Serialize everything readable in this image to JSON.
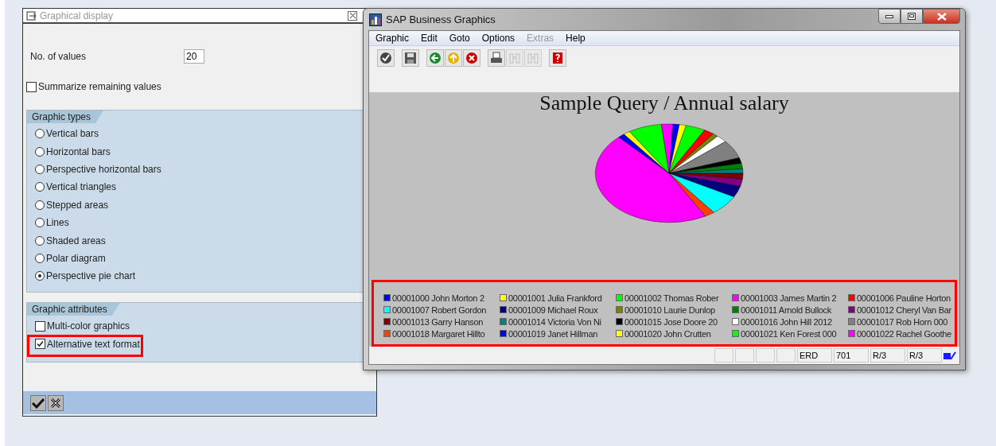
{
  "dialog": {
    "title": "Graphical display",
    "number_of_values": {
      "label": "No. of values",
      "value": "20"
    },
    "summarize": {
      "label": "Summarize remaining values",
      "checked": false
    },
    "graphic_types": {
      "title": "Graphic types",
      "options": [
        {
          "label": "Vertical bars",
          "selected": false
        },
        {
          "label": "Horizontal bars",
          "selected": false
        },
        {
          "label": "Perspective horizontal bars",
          "selected": false
        },
        {
          "label": "Vertical triangles",
          "selected": false
        },
        {
          "label": "Stepped areas",
          "selected": false
        },
        {
          "label": "Lines",
          "selected": false
        },
        {
          "label": "Shaded areas",
          "selected": false
        },
        {
          "label": "Polar diagram",
          "selected": false
        },
        {
          "label": "Perspective pie chart",
          "selected": true
        }
      ]
    },
    "graphic_attributes": {
      "title": "Graphic attributes",
      "options": [
        {
          "label": "Multi-color graphics",
          "checked": false,
          "highlighted": false
        },
        {
          "label": "Alternative text format",
          "checked": true,
          "highlighted": true
        }
      ]
    },
    "buttons": [
      {
        "kind": "confirm"
      },
      {
        "kind": "cancel"
      }
    ]
  },
  "graphics_window": {
    "title": "SAP Business Graphics",
    "menu": [
      {
        "label": "Graphic",
        "disabled": false
      },
      {
        "label": "Edit",
        "disabled": false
      },
      {
        "label": "Goto",
        "disabled": false
      },
      {
        "label": "Options",
        "disabled": false
      },
      {
        "label": "Extras",
        "disabled": true
      },
      {
        "label": "Help",
        "disabled": false
      }
    ],
    "toolbar": [
      {
        "kind": "check",
        "disabled": false
      },
      {
        "kind": "save",
        "disabled": false
      },
      {
        "kind": "back",
        "disabled": false
      },
      {
        "kind": "exit",
        "disabled": false
      },
      {
        "kind": "cancel",
        "disabled": false
      },
      {
        "kind": "print",
        "disabled": false
      },
      {
        "kind": "find",
        "disabled": true
      },
      {
        "kind": "find-next",
        "disabled": true
      },
      {
        "kind": "help",
        "disabled": false
      }
    ],
    "chart_title": "Sample Query / Annual salary",
    "legend": {
      "highlighted": true,
      "items": [
        {
          "label": "00001000 John Morton 2",
          "color": "#0000ff"
        },
        {
          "label": "00001001 Julia Frankford",
          "color": "#ffff00"
        },
        {
          "label": "00001002 Thomas Rober",
          "color": "#00ff00"
        },
        {
          "label": "00001003 James Martin 2",
          "color": "#ff00ff"
        },
        {
          "label": "00001006 Pauline Horton",
          "color": "#ff0000"
        },
        {
          "label": "00001007 Robert Gordon",
          "color": "#00ffff"
        },
        {
          "label": "00001009 Michael Roux",
          "color": "#000080"
        },
        {
          "label": "00001010 Laurie Dunlop",
          "color": "#808000"
        },
        {
          "label": "00001011 Arnold Bullock",
          "color": "#008000"
        },
        {
          "label": "00001012 Cheryl Van Bar",
          "color": "#800080"
        },
        {
          "label": "00001013 Garry Hanson",
          "color": "#800000"
        },
        {
          "label": "00001014 Victoria Von Ni",
          "color": "#008080"
        },
        {
          "label": "00001015 Jose Doore 20",
          "color": "#000000"
        },
        {
          "label": "00001016 John Hill 2012",
          "color": "#ffffff"
        },
        {
          "label": "00001017 Rob Horn 000",
          "color": "#808080"
        },
        {
          "label": "00001018 Margaret Hillto",
          "color": "#ff4000"
        },
        {
          "label": "00001019 Janet Hillman",
          "color": "#0000ff"
        },
        {
          "label": "00001020 John Crutten",
          "color": "#ffff00"
        },
        {
          "label": "00001021 Ken Forest 000",
          "color": "#00ff00"
        },
        {
          "label": "00001022 Rachel Goothe",
          "color": "#ff00ff"
        }
      ]
    },
    "status_fields": [
      "ERD",
      "701",
      "R/3",
      "R/3"
    ]
  }
}
